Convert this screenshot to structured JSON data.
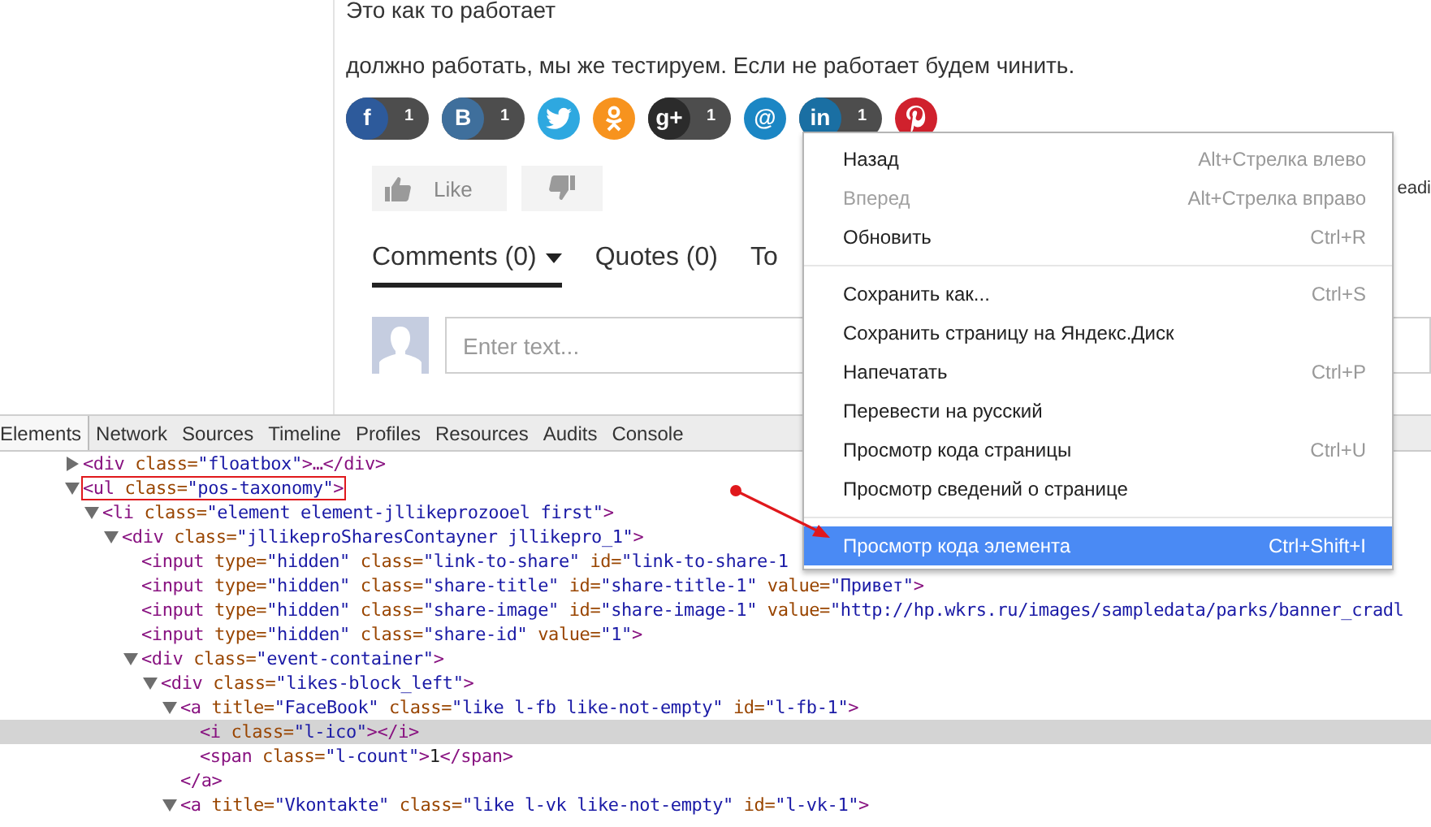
{
  "article": {
    "paragraphs": [
      "Это как то работает",
      "должно работать, мы же тестируем. Если не работает будем чинить."
    ]
  },
  "share_buttons": [
    {
      "kind": "letter",
      "glyph": "f",
      "color": "#2d5a9b",
      "count": "1"
    },
    {
      "kind": "letter",
      "glyph": "B",
      "color": "#3f6f9c",
      "count": "1"
    },
    {
      "kind": "bird",
      "color": "#2ea8e0"
    },
    {
      "kind": "ok",
      "color": "#f7931e"
    },
    {
      "kind": "letter",
      "glyph": "g+",
      "color": "#2b2b2b",
      "count": "1"
    },
    {
      "kind": "letter",
      "glyph": "@",
      "color": "#1b86c4"
    },
    {
      "kind": "letter",
      "glyph": "in",
      "color": "#1a6fa3",
      "count": "1"
    },
    {
      "kind": "pin",
      "color": "#d0212d"
    }
  ],
  "votes": {
    "like_label": "Like",
    "side_text": "eadi"
  },
  "tabs": [
    {
      "label": "Comments (0)",
      "selected": true,
      "caret": true
    },
    {
      "label": "Quotes (0)",
      "selected": false,
      "caret": false
    },
    {
      "label": "To",
      "selected": false,
      "caret": false
    }
  ],
  "comment": {
    "placeholder": "Enter text..."
  },
  "devtools": {
    "tabs": [
      {
        "label": "Elements",
        "selected": true
      },
      {
        "label": "Network",
        "selected": false
      },
      {
        "label": "Sources",
        "selected": false
      },
      {
        "label": "Timeline",
        "selected": false
      },
      {
        "label": "Profiles",
        "selected": false
      },
      {
        "label": "Resources",
        "selected": false
      },
      {
        "label": "Audits",
        "selected": false
      },
      {
        "label": "Console",
        "selected": false
      }
    ],
    "tree": [
      {
        "expanded": false,
        "selected": false,
        "boxed": false,
        "tokens": [
          {
            "kind": "tag",
            "text": "<div"
          },
          {
            "kind": "attr",
            "text": " class="
          },
          {
            "kind": "value",
            "text": "\"floatbox\""
          },
          {
            "kind": "tag",
            "text": ">…</div>"
          }
        ]
      },
      {
        "expanded": true,
        "selected": false,
        "boxed": true,
        "tokens": [
          {
            "kind": "tag",
            "text": "<ul"
          },
          {
            "kind": "attr",
            "text": " class="
          },
          {
            "kind": "value",
            "text": "\"pos-taxonomy\""
          },
          {
            "kind": "tag",
            "text": ">"
          }
        ],
        "children": [
          {
            "expanded": true,
            "selected": false,
            "boxed": false,
            "tokens": [
              {
                "kind": "tag",
                "text": "<li"
              },
              {
                "kind": "attr",
                "text": " class="
              },
              {
                "kind": "value",
                "text": "\"element element-jllikeprozooel first\""
              },
              {
                "kind": "tag",
                "text": ">"
              }
            ],
            "children": [
              {
                "expanded": true,
                "selected": false,
                "boxed": false,
                "tokens": [
                  {
                    "kind": "tag",
                    "text": "<div"
                  },
                  {
                    "kind": "attr",
                    "text": " class="
                  },
                  {
                    "kind": "value",
                    "text": "\"jllikeproSharesContayner jllikepro_1\""
                  },
                  {
                    "kind": "tag",
                    "text": ">"
                  }
                ],
                "children": [
                  {
                    "selected": false,
                    "boxed": false,
                    "tokens": [
                      {
                        "kind": "tag",
                        "text": "<input"
                      },
                      {
                        "kind": "attr",
                        "text": " type="
                      },
                      {
                        "kind": "value",
                        "text": "\"hidden\""
                      },
                      {
                        "kind": "attr",
                        "text": " class="
                      },
                      {
                        "kind": "value",
                        "text": "\"link-to-share\""
                      },
                      {
                        "kind": "attr",
                        "text": " id="
                      },
                      {
                        "kind": "value",
                        "text": "\"link-to-share-1"
                      }
                    ]
                  },
                  {
                    "selected": false,
                    "boxed": false,
                    "tokens": [
                      {
                        "kind": "tag",
                        "text": "<input"
                      },
                      {
                        "kind": "attr",
                        "text": " type="
                      },
                      {
                        "kind": "value",
                        "text": "\"hidden\""
                      },
                      {
                        "kind": "attr",
                        "text": " class="
                      },
                      {
                        "kind": "value",
                        "text": "\"share-title\""
                      },
                      {
                        "kind": "attr",
                        "text": " id="
                      },
                      {
                        "kind": "value",
                        "text": "\"share-title-1\""
                      },
                      {
                        "kind": "attr",
                        "text": " value="
                      },
                      {
                        "kind": "value",
                        "text": "\"Привет\""
                      },
                      {
                        "kind": "tag",
                        "text": ">"
                      }
                    ]
                  },
                  {
                    "selected": false,
                    "boxed": false,
                    "tokens": [
                      {
                        "kind": "tag",
                        "text": "<input"
                      },
                      {
                        "kind": "attr",
                        "text": " type="
                      },
                      {
                        "kind": "value",
                        "text": "\"hidden\""
                      },
                      {
                        "kind": "attr",
                        "text": " class="
                      },
                      {
                        "kind": "value",
                        "text": "\"share-image\""
                      },
                      {
                        "kind": "attr",
                        "text": " id="
                      },
                      {
                        "kind": "value",
                        "text": "\"share-image-1\""
                      },
                      {
                        "kind": "attr",
                        "text": " value="
                      },
                      {
                        "kind": "value",
                        "text": "\"http://hp.wkrs.ru/images/sampledata/parks/banner_cradl"
                      }
                    ]
                  },
                  {
                    "selected": false,
                    "boxed": false,
                    "tokens": [
                      {
                        "kind": "tag",
                        "text": "<input"
                      },
                      {
                        "kind": "attr",
                        "text": " type="
                      },
                      {
                        "kind": "value",
                        "text": "\"hidden\""
                      },
                      {
                        "kind": "attr",
                        "text": " class="
                      },
                      {
                        "kind": "value",
                        "text": "\"share-id\""
                      },
                      {
                        "kind": "attr",
                        "text": " value="
                      },
                      {
                        "kind": "value",
                        "text": "\"1\""
                      },
                      {
                        "kind": "tag",
                        "text": ">"
                      }
                    ]
                  },
                  {
                    "expanded": true,
                    "selected": false,
                    "boxed": false,
                    "tokens": [
                      {
                        "kind": "tag",
                        "text": "<div"
                      },
                      {
                        "kind": "attr",
                        "text": " class="
                      },
                      {
                        "kind": "value",
                        "text": "\"event-container\""
                      },
                      {
                        "kind": "tag",
                        "text": ">"
                      }
                    ],
                    "children": [
                      {
                        "expanded": true,
                        "selected": false,
                        "boxed": false,
                        "tokens": [
                          {
                            "kind": "tag",
                            "text": "<div"
                          },
                          {
                            "kind": "attr",
                            "text": " class="
                          },
                          {
                            "kind": "value",
                            "text": "\"likes-block_left\""
                          },
                          {
                            "kind": "tag",
                            "text": ">"
                          }
                        ],
                        "children": [
                          {
                            "expanded": true,
                            "selected": false,
                            "boxed": false,
                            "tokens": [
                              {
                                "kind": "tag",
                                "text": "<a"
                              },
                              {
                                "kind": "attr",
                                "text": " title="
                              },
                              {
                                "kind": "value",
                                "text": "\"FaceBook\""
                              },
                              {
                                "kind": "attr",
                                "text": " class="
                              },
                              {
                                "kind": "value",
                                "text": "\"like l-fb like-not-empty\""
                              },
                              {
                                "kind": "attr",
                                "text": " id="
                              },
                              {
                                "kind": "value",
                                "text": "\"l-fb-1\""
                              },
                              {
                                "kind": "tag",
                                "text": ">"
                              }
                            ],
                            "closing": [
                              {
                                "kind": "tag",
                                "text": "</a>"
                              }
                            ],
                            "children": [
                              {
                                "selected": true,
                                "boxed": false,
                                "tokens": [
                                  {
                                    "kind": "tag",
                                    "text": "<i"
                                  },
                                  {
                                    "kind": "attr",
                                    "text": " class="
                                  },
                                  {
                                    "kind": "value",
                                    "text": "\"l-ico\""
                                  },
                                  {
                                    "kind": "tag",
                                    "text": "></i>"
                                  }
                                ]
                              },
                              {
                                "selected": false,
                                "boxed": false,
                                "tokens": [
                                  {
                                    "kind": "tag",
                                    "text": "<span"
                                  },
                                  {
                                    "kind": "attr",
                                    "text": " class="
                                  },
                                  {
                                    "kind": "value",
                                    "text": "\"l-count\""
                                  },
                                  {
                                    "kind": "tag",
                                    "text": ">"
                                  },
                                  {
                                    "kind": "text",
                                    "text": "1"
                                  },
                                  {
                                    "kind": "tag",
                                    "text": "</span>"
                                  }
                                ]
                              }
                            ]
                          },
                          {
                            "expanded": true,
                            "selected": false,
                            "boxed": false,
                            "tokens": [
                              {
                                "kind": "tag",
                                "text": "<a"
                              },
                              {
                                "kind": "attr",
                                "text": " title="
                              },
                              {
                                "kind": "value",
                                "text": "\"Vkontakte\""
                              },
                              {
                                "kind": "attr",
                                "text": " class="
                              },
                              {
                                "kind": "value",
                                "text": "\"like l-vk like-not-empty\""
                              },
                              {
                                "kind": "attr",
                                "text": " id="
                              },
                              {
                                "kind": "value",
                                "text": "\"l-vk-1\""
                              },
                              {
                                "kind": "tag",
                                "text": ">"
                              }
                            ]
                          }
                        ]
                      }
                    ]
                  }
                ]
              }
            ]
          }
        ]
      }
    ]
  },
  "context_menu": {
    "groups": [
      {
        "items": [
          {
            "label": "Назад",
            "shortcut": "Alt+Стрелка влево",
            "disabled": false,
            "selected": false
          },
          {
            "label": "Вперед",
            "shortcut": "Alt+Стрелка вправо",
            "disabled": true,
            "selected": false
          },
          {
            "label": "Обновить",
            "shortcut": "Ctrl+R",
            "disabled": false,
            "selected": false
          }
        ]
      },
      {
        "items": [
          {
            "label": "Сохранить как...",
            "shortcut": "Ctrl+S",
            "disabled": false,
            "selected": false
          },
          {
            "label": "Сохранить страницу на Яндекс.Диск",
            "disabled": false,
            "selected": false
          },
          {
            "label": "Напечатать",
            "shortcut": "Ctrl+P",
            "disabled": false,
            "selected": false
          },
          {
            "label": "Перевести на русский",
            "disabled": false,
            "selected": false
          },
          {
            "label": "Просмотр кода страницы",
            "shortcut": "Ctrl+U",
            "disabled": false,
            "selected": false
          },
          {
            "label": "Просмотр сведений о странице",
            "disabled": false,
            "selected": false
          }
        ]
      },
      {
        "items": [
          {
            "label": "Просмотр кода элемента",
            "shortcut": "Ctrl+Shift+I",
            "disabled": false,
            "selected": true
          }
        ]
      }
    ]
  }
}
